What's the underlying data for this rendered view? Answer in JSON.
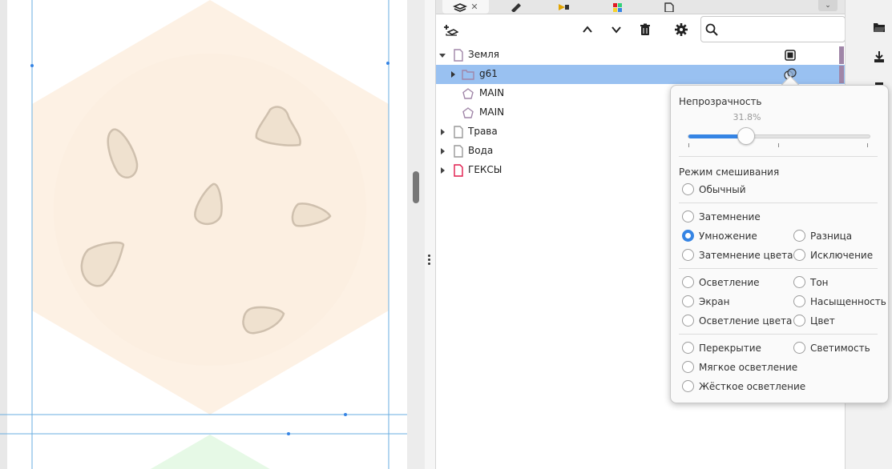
{
  "colors": {
    "accent": "#3584e4",
    "selection": "#99c1f1",
    "layer_color_tag": "#a086a8",
    "hexagon_fill": "#fdf1e4",
    "hexagon_fill_inner": "#f8ebdc",
    "green_hexagon_fill": "#e6f9e6",
    "guide_line": "#6aaee0"
  },
  "toolbar": {
    "search": {
      "value": "",
      "placeholder": ""
    }
  },
  "layers": [
    {
      "label": "Земля",
      "level": 0,
      "expanded": true,
      "icon": "layer-icon",
      "selected": false
    },
    {
      "label": "g61",
      "level": 1,
      "expanded": false,
      "icon": "group-folder-icon",
      "selected": true
    },
    {
      "label": "MAIN",
      "level": 1,
      "expanded": null,
      "icon": "polygon-icon",
      "selected": false
    },
    {
      "label": "MAIN",
      "level": 1,
      "expanded": null,
      "icon": "polygon-icon",
      "selected": false
    },
    {
      "label": "Трава",
      "level": 0,
      "expanded": false,
      "icon": "layer-icon",
      "selected": false
    },
    {
      "label": "Вода",
      "level": 0,
      "expanded": false,
      "icon": "layer-icon",
      "selected": false
    },
    {
      "label": "ГЕКСЫ",
      "level": 0,
      "expanded": false,
      "icon": "layer-red-icon",
      "selected": false
    }
  ],
  "popover": {
    "opacity_label": "Непрозрачность",
    "opacity_value": "31.8%",
    "opacity_fraction": 0.318,
    "blend_label": "Режим смешивания",
    "modes": [
      {
        "label": "Обычный",
        "checked": false
      },
      {
        "label": "Затемнение",
        "checked": false
      },
      {
        "label": "Умножение",
        "checked": true
      },
      {
        "label": "Затемнение цвета",
        "checked": false
      },
      {
        "label": "Разница",
        "checked": false
      },
      {
        "label": "Исключение",
        "checked": false
      },
      {
        "label": "Осветление",
        "checked": false
      },
      {
        "label": "Экран",
        "checked": false
      },
      {
        "label": "Осветление цвета",
        "checked": false
      },
      {
        "label": "Тон",
        "checked": false
      },
      {
        "label": "Насыщенность",
        "checked": false
      },
      {
        "label": "Цвет",
        "checked": false
      },
      {
        "label": "Перекрытие",
        "checked": false
      },
      {
        "label": "Мягкое осветление",
        "checked": false
      },
      {
        "label": "Жёсткое осветление",
        "checked": false
      },
      {
        "label": "Светимость",
        "checked": false
      }
    ]
  }
}
